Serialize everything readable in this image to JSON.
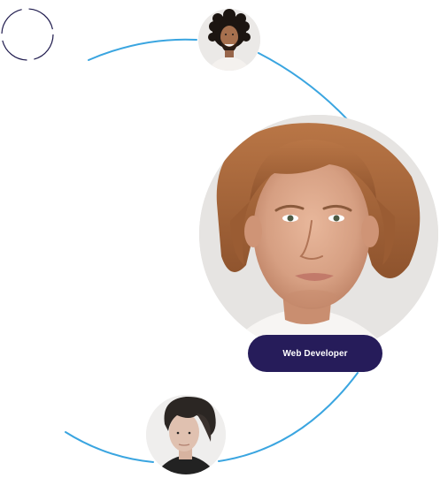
{
  "featured_profile": {
    "role_label": "Web Developer"
  },
  "colors": {
    "orbit_line": "#3aa5e0",
    "dashed_ring": "#1e1a4d",
    "badge_background": "#261c5a",
    "badge_text": "#ffffff",
    "avatar_backdrop": "#e9e7e5"
  },
  "icons": {
    "decorative_ring": "dashed-ring-icon",
    "avatar_top": "avatar-curly-hair-man",
    "avatar_main": "avatar-wavy-hair-man",
    "avatar_bottom": "avatar-styled-hair-man"
  }
}
